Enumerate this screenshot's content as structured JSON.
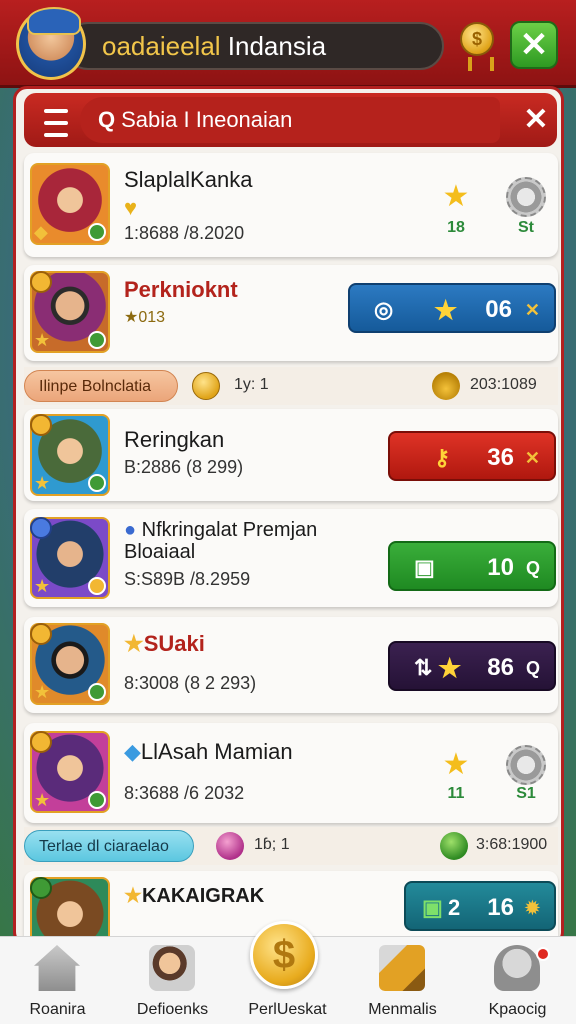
{
  "header": {
    "title_prefix": "oadaieelal",
    "title_main": " Indansia",
    "medal_symbol": "$",
    "close_symbol": "✕"
  },
  "search": {
    "query_icon": "Q",
    "text": "Sabia I Ineonaian",
    "close_symbol": "✕"
  },
  "cards": [
    {
      "name": "SlaplalKanka",
      "sub": "1:8688 /8.2020",
      "extra": "",
      "star_count": "18",
      "gear_label": "St"
    },
    {
      "name": "Perknioknt",
      "sub": "",
      "extra": "013",
      "action_value": "06"
    },
    {
      "name": "Reringkan",
      "sub": "B:2886 (8 299)",
      "action_value": "36"
    },
    {
      "name": "Nfkringalat Premjan",
      "name2": "Bloaiaal",
      "sub": "S:S89B /8.2959",
      "action_value": "10"
    },
    {
      "name": "SUaki",
      "sub": "8:3008 (8 2 293)",
      "action_value": "86"
    },
    {
      "name": "LlAsah Mamian",
      "sub": "8:3688 /6 2032",
      "star_count": "11",
      "gear_label": "S1"
    },
    {
      "name": "KAKAIGRAK",
      "sub": "",
      "action_value": "16"
    }
  ],
  "sections": [
    {
      "tag": "Ilinpe Bolnclatia",
      "mid_text": "1y: 1",
      "right_text": "203:1089"
    },
    {
      "tag": "Terlae dl ciaraelao",
      "mid_text": "1ɓ; 1",
      "right_text": "3:68:1900"
    }
  ],
  "actions": {
    "card2_tail": "✕",
    "card3_tail": "✕",
    "card4_tail": "Q",
    "card5_tail": "Q",
    "card7_prefix": "2"
  },
  "nav": [
    {
      "label": "Roanira",
      "icon": "home-icon"
    },
    {
      "label": "Defioenks",
      "icon": "friends-icon"
    },
    {
      "label": "PerlUeskat",
      "icon": "coin-icon"
    },
    {
      "label": "Menmalis",
      "icon": "pencil-icon"
    },
    {
      "label": "Kpaocig",
      "icon": "robot-icon"
    }
  ],
  "colors": {
    "brand_red": "#b81f1f",
    "accent_gold": "#f2c64a",
    "blue_action": "#2c7ac2",
    "red_action": "#df3326",
    "green_action": "#3aae3a",
    "dark_action": "#3b2150",
    "teal_action": "#238a9a"
  }
}
